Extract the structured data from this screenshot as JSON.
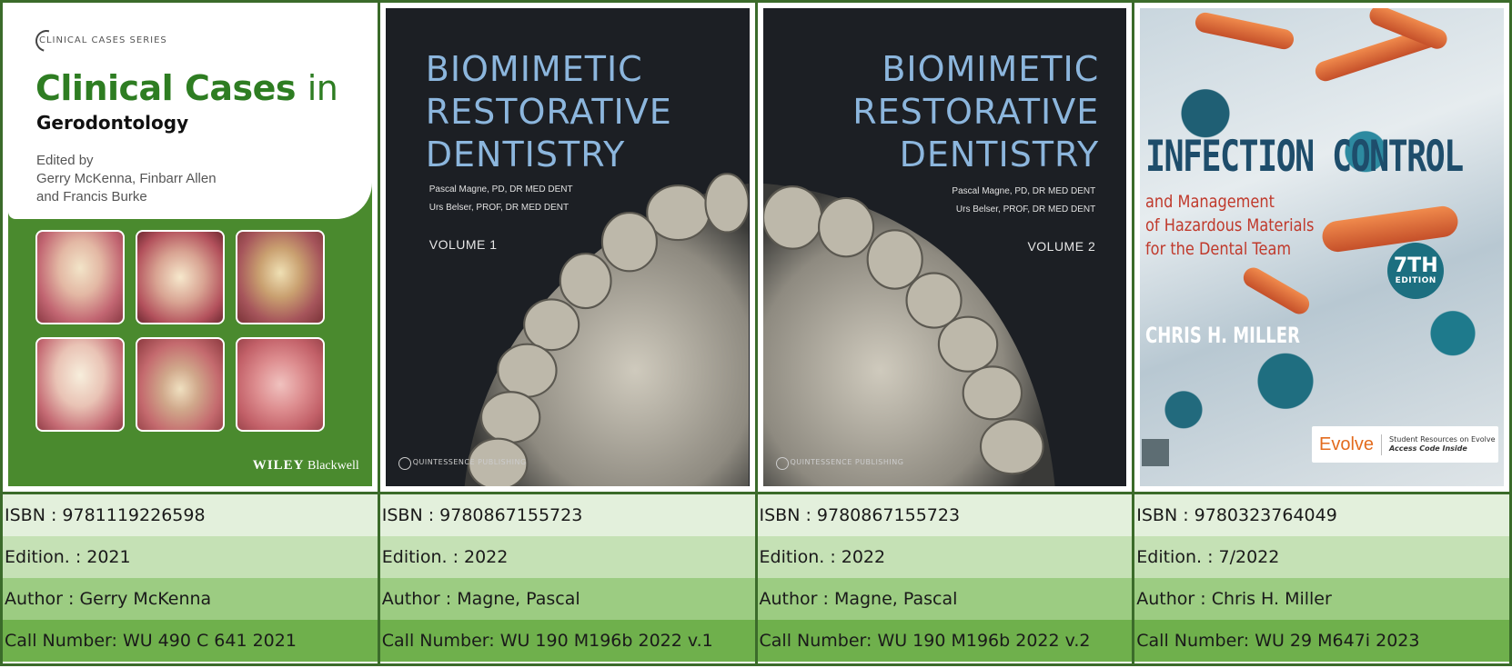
{
  "books": [
    {
      "cover": {
        "series": "CLINICAL CASES SERIES",
        "title_main": "Clinical Cases",
        "title_in": "in",
        "title_sub": "Gerodontology",
        "edited_by": "Edited by",
        "editors_line1": "Gerry McKenna, Finbarr Allen",
        "editors_line2": "and Francis Burke",
        "publisher_bold": "WILEY",
        "publisher_rest": "Blackwell"
      },
      "isbn": "ISBN : 9781119226598",
      "edition": "Edition. : 2021",
      "author": "Author : Gerry McKenna",
      "call_number": "Call Number: WU 490  C 641 2021"
    },
    {
      "cover": {
        "title_1": "BIOMIMETIC",
        "title_2": "RESTORATIVE",
        "title_3": "DENTISTRY",
        "author_1": "Pascal Magne, PD, DR MED DENT",
        "author_2": "Urs Belser, PROF, DR MED DENT",
        "volume": "VOLUME 1",
        "publisher": "QUINTESSENCE PUBLISHING"
      },
      "isbn": "ISBN : 9780867155723",
      "edition": "Edition. : 2022",
      "author": "Author : Magne, Pascal",
      "call_number": "Call Number: WU 190 M196b 2022 v.1"
    },
    {
      "cover": {
        "title_1": "BIOMIMETIC",
        "title_2": "RESTORATIVE",
        "title_3": "DENTISTRY",
        "author_1": "Pascal Magne, PD, DR MED DENT",
        "author_2": "Urs Belser, PROF, DR MED DENT",
        "volume": "VOLUME 2",
        "publisher": "QUINTESSENCE PUBLISHING"
      },
      "isbn": "ISBN : 9780867155723",
      "edition": "Edition. : 2022",
      "author": "Author : Magne, Pascal",
      "call_number": "Call Number: WU 190 M196b 2022 v.2"
    },
    {
      "cover": {
        "title_main": "INFECTION CONTROL",
        "sub_1": "and Management",
        "sub_2": "of Hazardous Materials",
        "sub_3": "for the Dental Team",
        "edition_num": "7TH",
        "edition_word": "EDITION",
        "author": "CHRIS H. MILLER",
        "evolve": "Evolve",
        "evolve_sub_1": "Student Resources on Evolve",
        "evolve_sub_2": "Access Code Inside"
      },
      "isbn": "ISBN : 9780323764049",
      "edition": "Edition. : 7/2022",
      "author": "Author : Chris H. Miller",
      "call_number": "Call Number: WU 29 M647i 2023"
    }
  ],
  "colors": {
    "border": "#3b6b2a",
    "row_1": "#e3f0dc",
    "row_2": "#c5e1b5",
    "row_3": "#9ccc82",
    "row_4": "#6fb04c"
  }
}
